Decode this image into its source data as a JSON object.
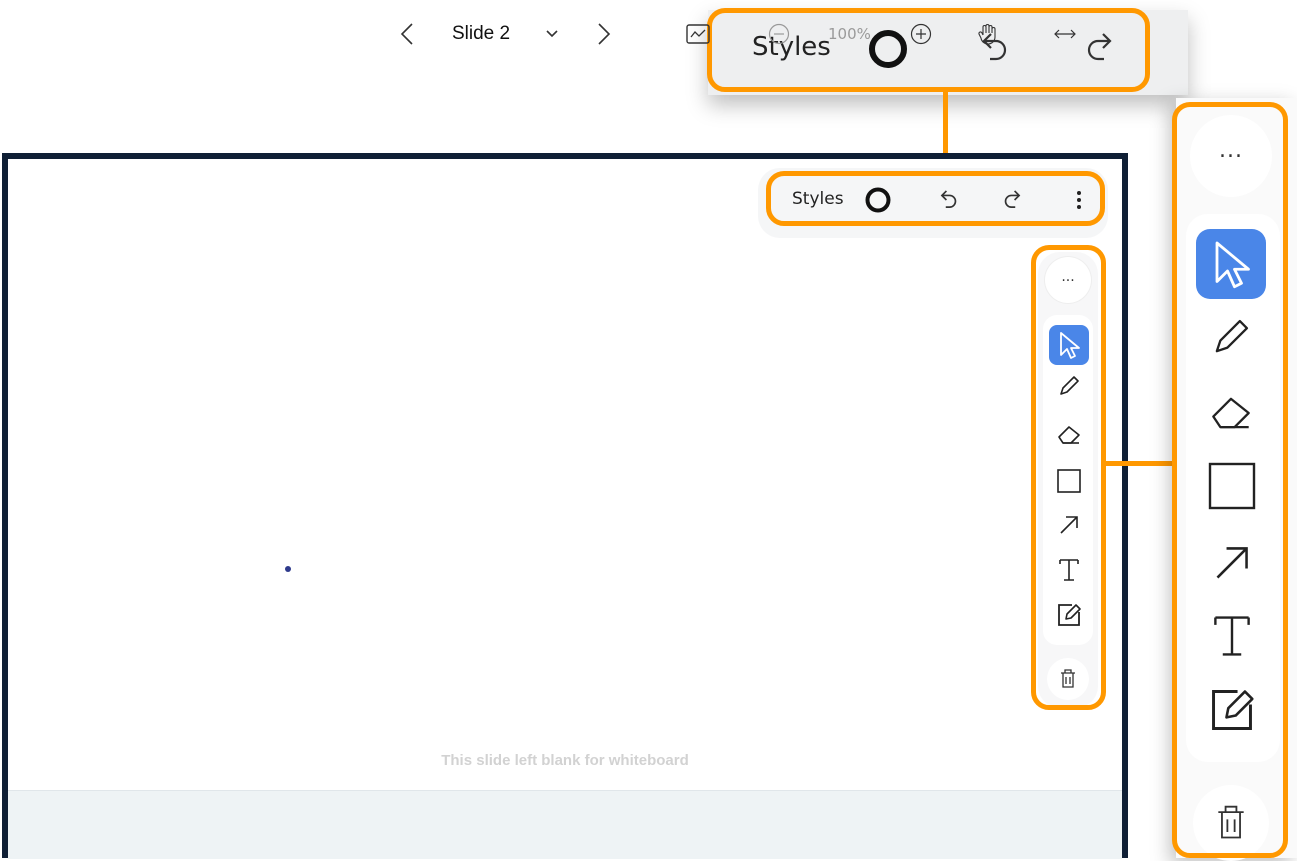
{
  "toolbar": {
    "styles_label": "Styles",
    "icons": [
      "circle-style-icon",
      "undo-icon",
      "redo-icon",
      "more-vertical-icon"
    ]
  },
  "tools": {
    "more_label": "...",
    "items": [
      "select-icon",
      "pencil-icon",
      "eraser-icon",
      "rectangle-icon",
      "arrow-icon",
      "text-icon",
      "note-icon"
    ],
    "delete": "trash-icon",
    "active_color": "#4a86e8"
  },
  "canvas": {
    "caption": "This slide left blank for whiteboard"
  },
  "footer": {
    "slide_label": "Slide 2",
    "zoom_value": "100%"
  },
  "colors": {
    "highlight": "#ff9800",
    "frame_border": "#0f1f35",
    "footer_bg": "#eef3f5"
  }
}
